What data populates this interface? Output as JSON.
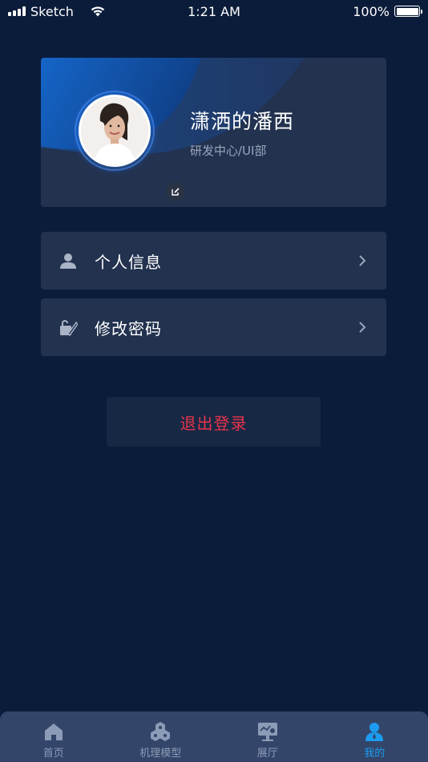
{
  "status_bar": {
    "carrier": "Sketch",
    "time": "1:21 AM",
    "battery": "100%"
  },
  "profile": {
    "name": "潇洒的潘西",
    "department": "研发中心/UI部"
  },
  "menu": [
    {
      "label": "个人信息",
      "icon": "user-icon"
    },
    {
      "label": "修改密码",
      "icon": "lock-edit-icon"
    }
  ],
  "logout": {
    "label": "退出登录",
    "color": "#e8344a"
  },
  "tabs": [
    {
      "label": "首页",
      "icon": "home-icon",
      "active": false
    },
    {
      "label": "机理模型",
      "icon": "model-icon",
      "active": false
    },
    {
      "label": "展厅",
      "icon": "exhibition-icon",
      "active": false
    },
    {
      "label": "我的",
      "icon": "profile-icon",
      "active": true
    }
  ],
  "colors": {
    "background": "#0b1c3a",
    "card": "#22324f",
    "accent": "#1b9cf0",
    "tab_bar": "#33466a"
  }
}
